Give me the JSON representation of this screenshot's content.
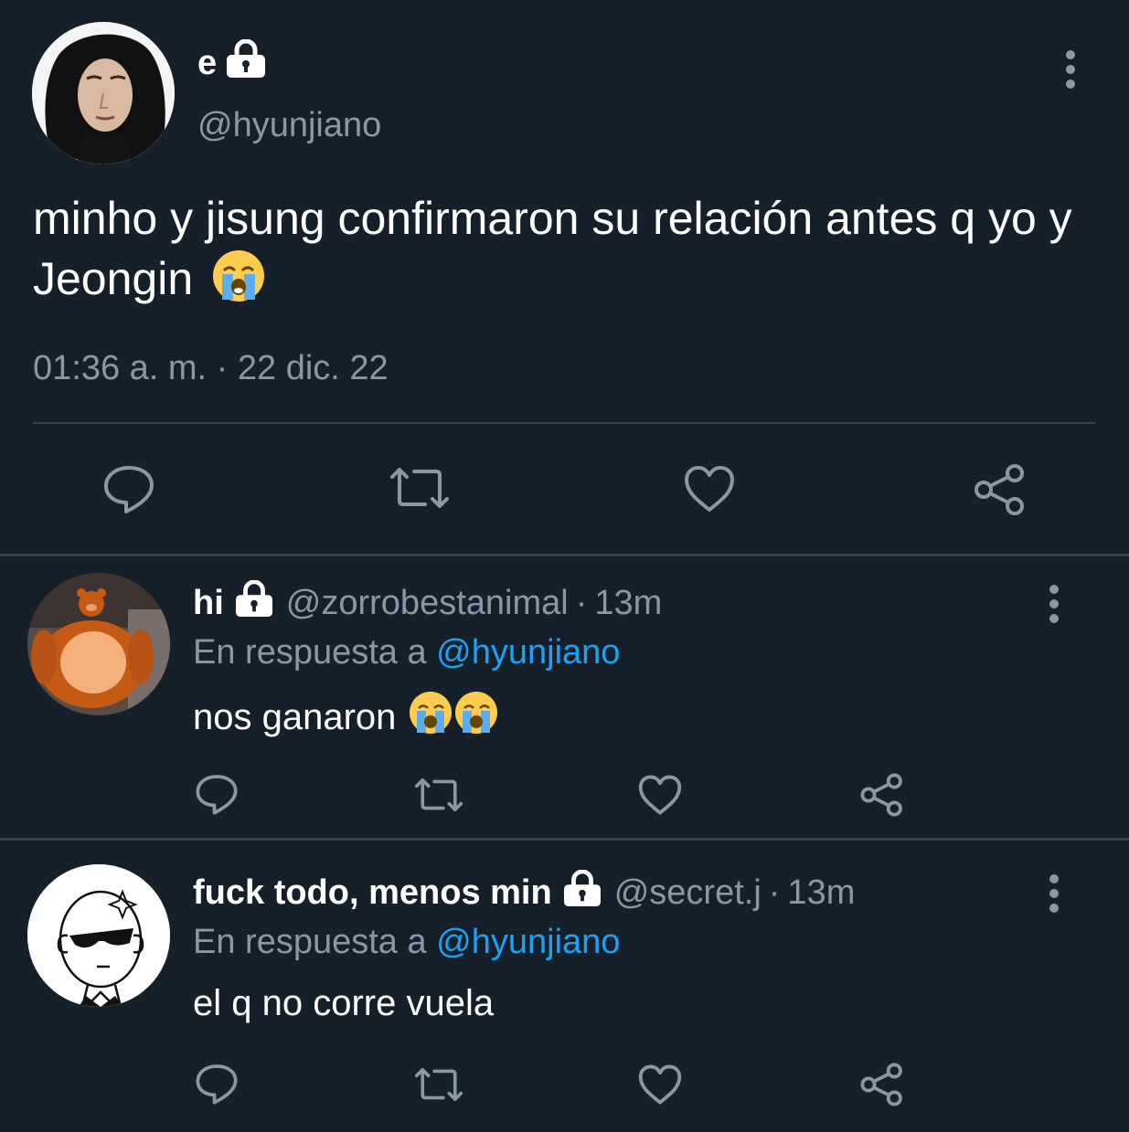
{
  "main_tweet": {
    "display_name": "e",
    "handle": "@hyunjiano",
    "text": "minho y jisung confirmaron su relación antes q yo y Jeongin",
    "emoji": "😭",
    "timestamp": "01:36 a. m. · 22 dic. 22",
    "actions": [
      "reply-icon",
      "retweet-icon",
      "like-icon",
      "share-icon"
    ]
  },
  "replies": [
    {
      "display_name": "hi",
      "handle": "@zorrobestanimal",
      "separator": "·",
      "time": "13m",
      "reply_prefix": "En respuesta a",
      "reply_mention": "@hyunjiano",
      "text": "nos ganaron",
      "emoji": "😭😭"
    },
    {
      "display_name": "fuck todo, menos min",
      "handle": "@secret.j",
      "separator": "·",
      "time": "13m",
      "reply_prefix": "En respuesta a",
      "reply_mention": "@hyunjiano",
      "text": "el q no corre vuela",
      "emoji": ""
    }
  ],
  "colors": {
    "background": "#15202b",
    "text_primary": "#ffffff",
    "text_secondary": "#8899a6",
    "mention": "#1da1f2",
    "divider": "#38444d"
  }
}
